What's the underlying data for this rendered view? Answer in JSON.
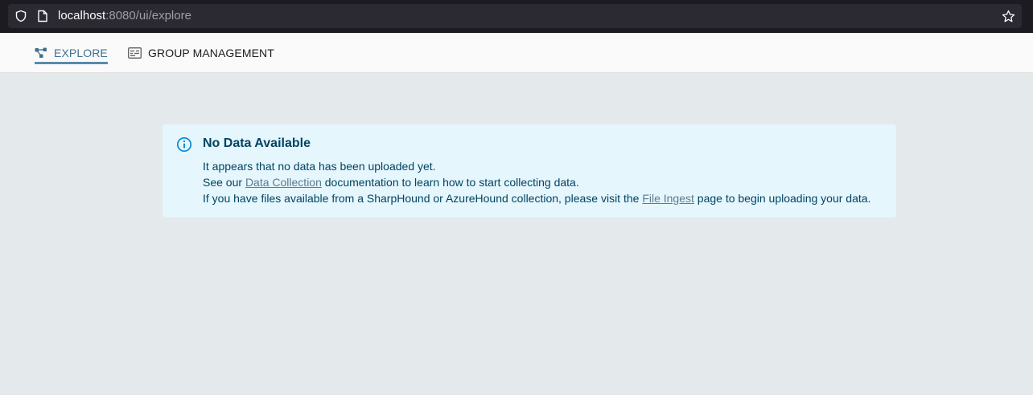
{
  "browser": {
    "url_host": "localhost",
    "url_path": ":8080/ui/explore"
  },
  "nav": {
    "tabs": [
      {
        "label": "EXPLORE",
        "icon": "graph-icon",
        "active": true
      },
      {
        "label": "GROUP MANAGEMENT",
        "icon": "id-card-icon",
        "active": false
      }
    ]
  },
  "alert": {
    "icon": "info-icon",
    "title": "No Data Available",
    "line1": "It appears that no data has been uploaded yet.",
    "line2_prefix": "See our ",
    "line2_link": "Data Collection",
    "line2_suffix": " documentation to learn how to start collecting data.",
    "line3_prefix": "If you have files available from a SharpHound or AzureHound collection, please visit the ",
    "line3_link": "File Ingest",
    "line3_suffix": " page to begin uploading your data."
  },
  "colors": {
    "accent": "#406f8e",
    "alert_bg": "#e5f6fd",
    "alert_text": "#014361",
    "page_bg": "#e4e9ec"
  }
}
